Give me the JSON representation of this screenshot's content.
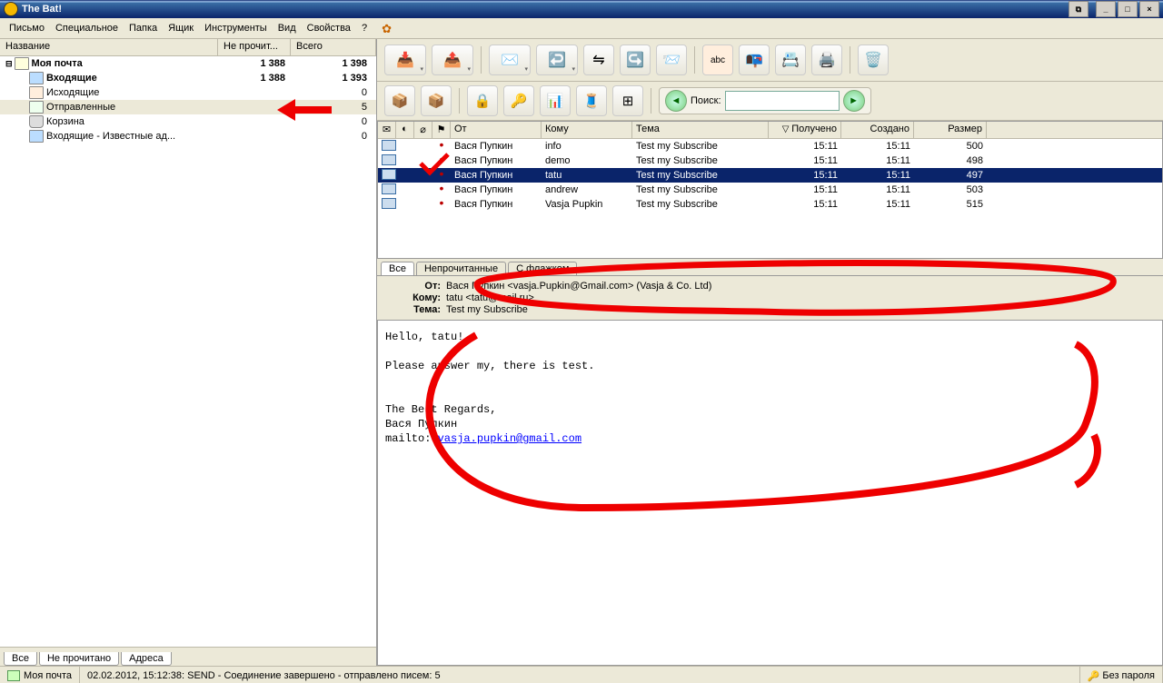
{
  "window": {
    "title": "The Bat!"
  },
  "menu": {
    "items": [
      "Письмо",
      "Специальное",
      "Папка",
      "Ящик",
      "Инструменты",
      "Вид",
      "Свойства",
      "?"
    ]
  },
  "tree": {
    "headers": {
      "name": "Название",
      "unread": "Не прочит...",
      "total": "Всего"
    },
    "root": {
      "label": "Моя почта",
      "unread": "1 388",
      "total": "1 398"
    },
    "items": [
      {
        "label": "Входящие",
        "unread": "1 388",
        "total": "1 393",
        "bold": true
      },
      {
        "label": "Исходящие",
        "unread": "",
        "total": "0"
      },
      {
        "label": "Отправленные",
        "unread": "",
        "total": "5",
        "selected": true
      },
      {
        "label": "Корзина",
        "unread": "",
        "total": "0"
      },
      {
        "label": "Входящие - Известные ад...",
        "unread": "",
        "total": "0"
      }
    ],
    "bottom_tabs": [
      "Все",
      "Не прочитано",
      "Адреса"
    ]
  },
  "search": {
    "label": "Поиск:"
  },
  "grid": {
    "headers": {
      "from": "От",
      "to": "Кому",
      "subject": "Тема",
      "received": "Получено",
      "created": "Создано",
      "size": "Размер"
    },
    "rows": [
      {
        "from": "Вася Пупкин",
        "to": "info",
        "subject": "Test my Subscribe",
        "received": "15:11",
        "created": "15:11",
        "size": "500"
      },
      {
        "from": "Вася Пупкин",
        "to": "demo",
        "subject": "Test my Subscribe",
        "received": "15:11",
        "created": "15:11",
        "size": "498"
      },
      {
        "from": "Вася Пупкин",
        "to": "tatu",
        "subject": "Test my Subscribe",
        "received": "15:11",
        "created": "15:11",
        "size": "497",
        "selected": true
      },
      {
        "from": "Вася Пупкин",
        "to": "andrew",
        "subject": "Test my Subscribe",
        "received": "15:11",
        "created": "15:11",
        "size": "503"
      },
      {
        "from": "Вася Пупкин",
        "to": "Vasja Pupkin",
        "subject": "Test my Subscribe",
        "received": "15:11",
        "created": "15:11",
        "size": "515"
      }
    ],
    "filter_tabs": [
      "Все",
      "Непрочитанные",
      "С флажком"
    ]
  },
  "message": {
    "header": {
      "from_label": "От:",
      "from_value": "Вася Пупкин <vasja.Pupkin@Gmail.com>  (Vasja & Co. Ltd)",
      "to_label": "Кому:",
      "to_value": "tatu <tatu@mail.ru>",
      "subject_label": "Тема:",
      "subject_value": "Test my Subscribe"
    },
    "body": {
      "line1": "Hello, tatu!",
      "line2": "Please answer my, there is test.",
      "line3": "The Best Regards,",
      "line4": "Вася Пупкин",
      "line5_prefix": "mailto: ",
      "line5_link": "vasja.pupkin@gmail.com"
    }
  },
  "status": {
    "account": "Моя почта",
    "log": "02.02.2012, 15:12:38: SEND  - Соединение завершено - отправлено писем: 5",
    "right": "Без пароля"
  }
}
